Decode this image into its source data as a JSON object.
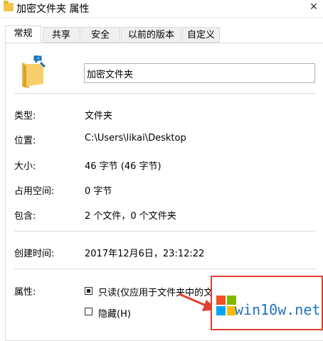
{
  "window": {
    "title": "加密文件夹 属性",
    "close_glyph": "✕"
  },
  "tabs": [
    {
      "label": "常规",
      "active": true
    },
    {
      "label": "共享",
      "active": false
    },
    {
      "label": "安全",
      "active": false
    },
    {
      "label": "以前的版本",
      "active": false
    },
    {
      "label": "自定义",
      "active": false
    }
  ],
  "general": {
    "folder_name": "加密文件夹",
    "fields": {
      "type": {
        "label": "类型:",
        "value": "文件夹"
      },
      "location": {
        "label": "位置:",
        "value": "C:\\Users\\likai\\Desktop"
      },
      "size": {
        "label": "大小:",
        "value": "46 字节 (46 字节)"
      },
      "disk_size": {
        "label": "占用空间:",
        "value": "0 字节"
      },
      "contains": {
        "label": "包含:",
        "value": "2 个文件，0 个文件夹"
      },
      "created": {
        "label": "创建时间:",
        "value": "2017年12月6日，23:12:22"
      }
    },
    "attributes": {
      "label": "属性:",
      "readonly": {
        "label": "只读(仅应用于文件夹中的文",
        "state": "indeterminate"
      },
      "hidden": {
        "label": "隐藏(H)",
        "state": "unchecked"
      }
    }
  },
  "watermark": {
    "text": "win10w.net",
    "accent_color": "#e04030",
    "text_color": "#1e73be"
  }
}
